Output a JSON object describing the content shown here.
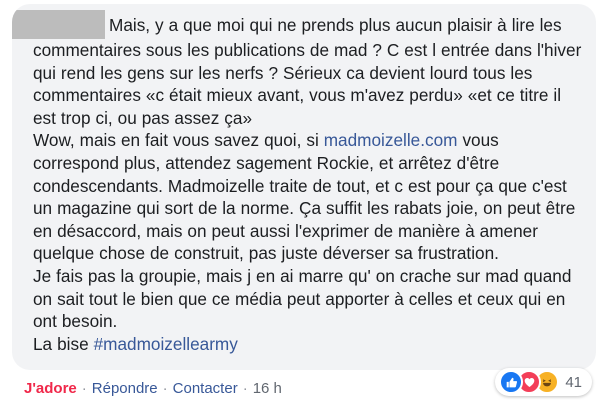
{
  "comment": {
    "author_redacted": true,
    "text_1": "Mais, y a que moi qui ne prends plus aucun plaisir à lire les commentaires sous les publications de mad ? C est l entrée dans l'hiver qui rend les gens sur les nerfs ? Sérieux ca devient lourd tous les commentaires «c était mieux avant, vous m'avez perdu» «et ce titre il est trop ci, ou pas assez ça»\nWow, mais en fait vous savez quoi, si ",
    "link_text": "madmoizelle.com",
    "text_2": " vous correspond plus, attendez sagement Rockie, et arrêtez d'être condescendants. Madmoizelle traite de tout, et c est pour ça que c'est un magazine qui sort de la norme. Ça suffit les rabats joie, on peut être en désaccord, mais on peut aussi l'exprimer de manière à amener quelque chose de construit, pas juste déverser sa frustration.\nJe fais pas la groupie, mais j en ai marre qu' on crache sur mad quand on sait tout le bien que ce média peut apporter à celles et ceux qui en ont besoin.\nLa bise ",
    "hashtag": "#madmoizellearmy"
  },
  "actions": {
    "like_label": "J'adore",
    "separator": "·",
    "reply_label": "Répondre",
    "contact_label": "Contacter",
    "time": "16 h"
  },
  "reactions": {
    "icons": [
      "like-icon",
      "love-icon",
      "haha-icon"
    ],
    "count": "41"
  },
  "colors": {
    "bubble": "#f2f3f5",
    "link": "#385898",
    "love_action": "#f0284a",
    "like": "#1877f2",
    "love": "#f33e58",
    "haha": "#f7b125"
  }
}
